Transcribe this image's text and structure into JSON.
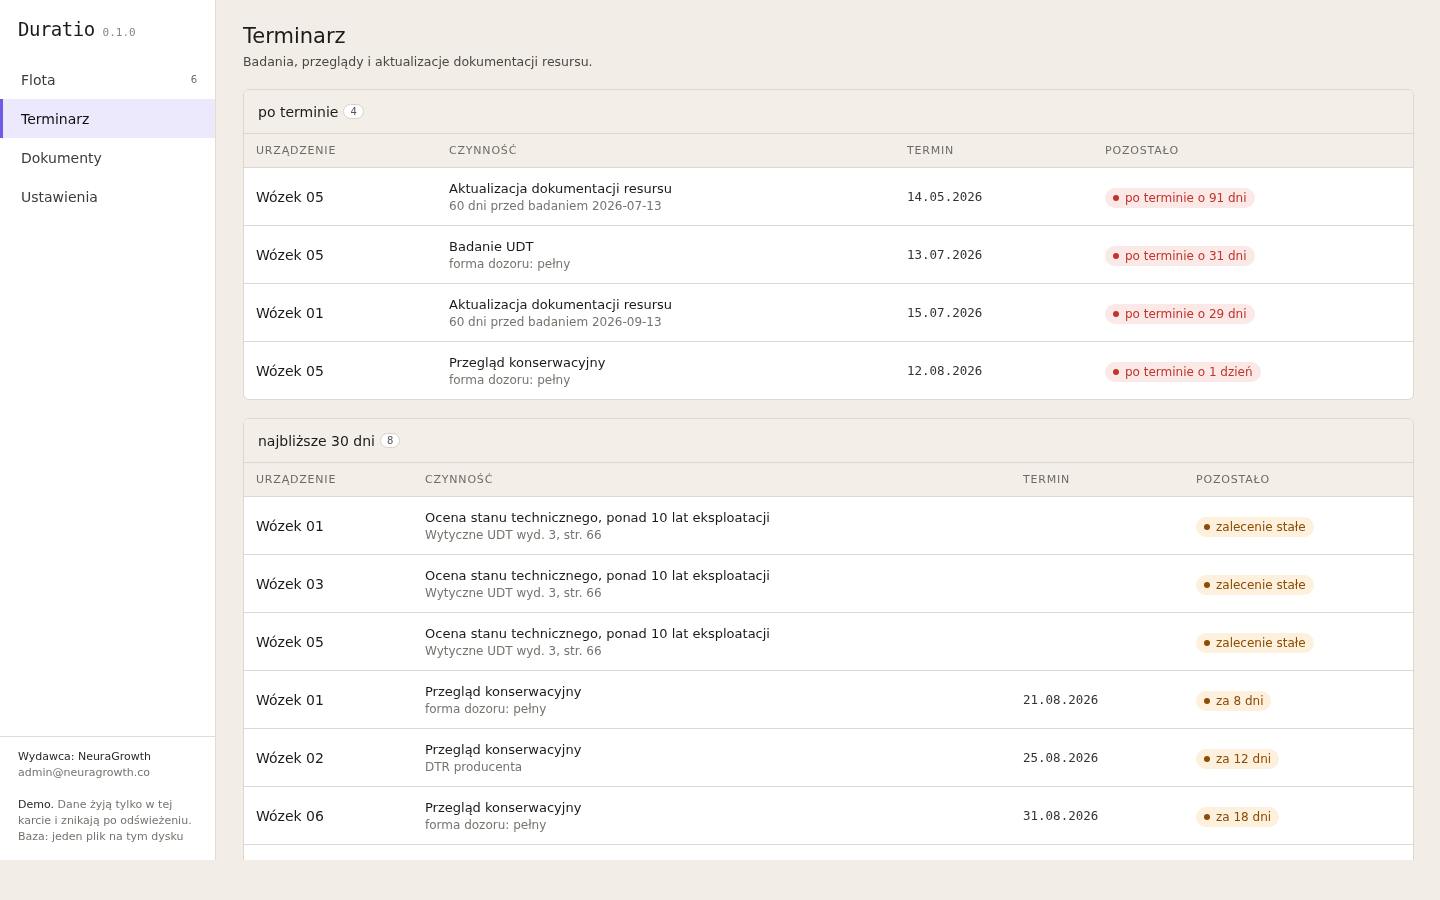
{
  "app": {
    "name": "Duratio",
    "version": "0.1.0"
  },
  "nav": [
    {
      "label": "Flota",
      "count": "6",
      "selected": false
    },
    {
      "label": "Terminarz",
      "selected": true
    },
    {
      "label": "Dokumenty",
      "selected": false
    },
    {
      "label": "Ustawienia",
      "selected": false
    }
  ],
  "footer": {
    "publisher": "Wydawca: NeuraGrowth",
    "email": "admin@neuragrowth.co",
    "demo": "**Demo.** Dane żyją tylko w tej karcie i znikają po odświeżeniu.",
    "storage": "Baza: jeden plik na tym dysku"
  },
  "page": {
    "title": "Terminarz",
    "subtitle": "Badania, przeglądy i aktualizacje dokumentacji resursu."
  },
  "sections": [
    {
      "title": "po terminie",
      "count": "4",
      "columns": [
        "URZĄDZENIE",
        "CZYNNOŚĆ",
        "TERMIN",
        "POZOSTAŁO"
      ],
      "rows": [
        {
          "device": "Wózek 05",
          "task": "Aktualizacja dokumentacji resursu",
          "note": "60 dni przed badaniem 2026-07-13",
          "date": "14.05.2026",
          "status": "po terminie o 91 dni",
          "kind": "overdue"
        },
        {
          "device": "Wózek 05",
          "task": "Badanie UDT",
          "note": "forma dozoru: pełny",
          "date": "13.07.2026",
          "status": "po terminie o 31 dni",
          "kind": "overdue"
        },
        {
          "device": "Wózek 01",
          "task": "Aktualizacja dokumentacji resursu",
          "note": "60 dni przed badaniem 2026-09-13",
          "date": "15.07.2026",
          "status": "po terminie o 29 dni",
          "kind": "overdue"
        },
        {
          "device": "Wózek 05",
          "task": "Przegląd konserwacyjny",
          "note": "forma dozoru: pełny",
          "date": "12.08.2026",
          "status": "po terminie o 1 dzień",
          "kind": "overdue"
        }
      ]
    },
    {
      "title": "najbliższe 30 dni",
      "count": "8",
      "columns": [
        "URZĄDZENIE",
        "CZYNNOŚĆ",
        "TERMIN",
        "POZOSTAŁO"
      ],
      "rows": [
        {
          "device": "Wózek 01",
          "task": "Ocena stanu technicznego, ponad 10 lat eksploatacji",
          "note": "Wytyczne UDT wyd. 3, str. 66",
          "status": "zalecenie stałe",
          "kind": "upcoming"
        },
        {
          "device": "Wózek 03",
          "task": "Ocena stanu technicznego, ponad 10 lat eksploatacji",
          "note": "Wytyczne UDT wyd. 3, str. 66",
          "status": "zalecenie stałe",
          "kind": "upcoming"
        },
        {
          "device": "Wózek 05",
          "task": "Ocena stanu technicznego, ponad 10 lat eksploatacji",
          "note": "Wytyczne UDT wyd. 3, str. 66",
          "status": "zalecenie stałe",
          "kind": "upcoming"
        },
        {
          "device": "Wózek 01",
          "task": "Przegląd konserwacyjny",
          "note": "forma dozoru: pełny",
          "date": "21.08.2026",
          "status": "za 8 dni",
          "kind": "upcoming"
        },
        {
          "device": "Wózek 02",
          "task": "Przegląd konserwacyjny",
          "note": "DTR producenta",
          "date": "25.08.2026",
          "status": "za 12 dni",
          "kind": "upcoming"
        },
        {
          "device": "Wózek 06",
          "task": "Przegląd konserwacyjny",
          "note": "forma dozoru: pełny",
          "date": "31.08.2026",
          "status": "za 18 dni",
          "kind": "upcoming"
        }
      ]
    }
  ]
}
